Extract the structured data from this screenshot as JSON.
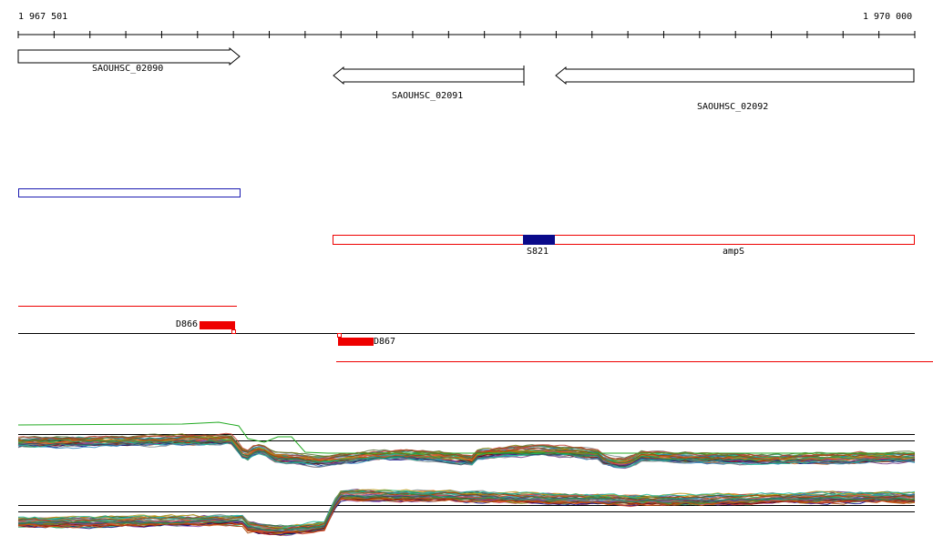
{
  "ruler": {
    "start_label": "1 967 501",
    "end_label": "1 970 000"
  },
  "genes": [
    {
      "name": "SAOUHSC_02090",
      "strand": "+"
    },
    {
      "name": "SAOUHSC_02091",
      "strand": "-"
    },
    {
      "name": "SAOUHSC_02092",
      "strand": "-"
    }
  ],
  "features": {
    "box_label": "S821",
    "gene_label": "ampS"
  },
  "segments": [
    {
      "label": "D866"
    },
    {
      "label": "D867"
    }
  ],
  "colors": {
    "gene": "#000000",
    "feature_box": "#0a0a8a",
    "red": "#ee0000",
    "blue_outline": "#1a1ab0"
  }
}
